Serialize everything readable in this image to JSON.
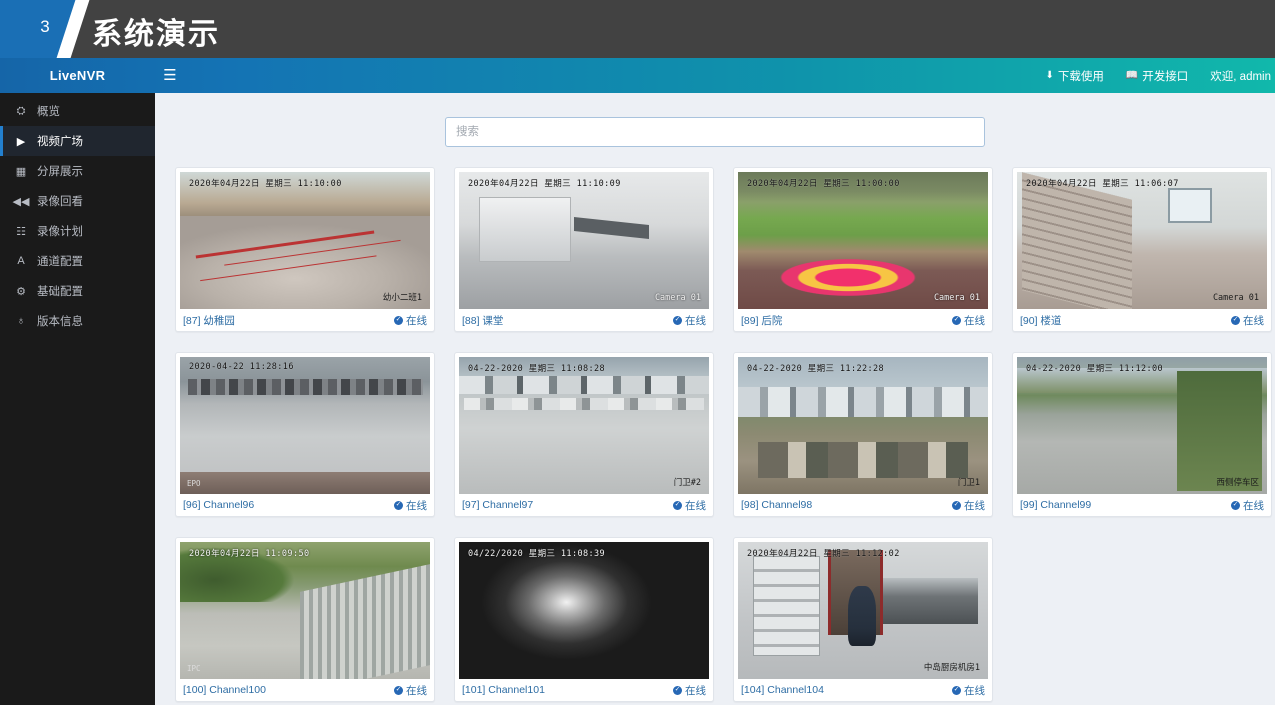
{
  "slide": {
    "number": "3",
    "title": "系统演示"
  },
  "navbar": {
    "brand": "LiveNVR",
    "menu_toggle_icon": "hamburger-icon",
    "right_items": [
      {
        "label": "下载使用",
        "icon": "download-icon"
      },
      {
        "label": "开发接口",
        "icon": "book-icon"
      },
      {
        "label": "欢迎, admin",
        "icon": ""
      }
    ]
  },
  "sidebar": {
    "items": [
      {
        "label": "概览",
        "icon": "dashboard-icon",
        "glyph": "⛭",
        "active": false
      },
      {
        "label": "视频广场",
        "icon": "play-icon",
        "glyph": "▶",
        "active": true
      },
      {
        "label": "分屏展示",
        "icon": "grid-icon",
        "glyph": "▦",
        "active": false
      },
      {
        "label": "录像回看",
        "icon": "rewind-icon",
        "glyph": "◀◀",
        "active": false
      },
      {
        "label": "录像计划",
        "icon": "calendar-icon",
        "glyph": "☷",
        "active": false
      },
      {
        "label": "通道配置",
        "icon": "font-a-icon",
        "glyph": "A",
        "active": false
      },
      {
        "label": "基础配置",
        "icon": "gear-icon",
        "glyph": "⚙",
        "active": false
      },
      {
        "label": "版本信息",
        "icon": "globe-icon",
        "glyph": "♁",
        "active": false
      }
    ]
  },
  "search": {
    "placeholder": "搜索",
    "value": ""
  },
  "status_label": "在线",
  "cards": [
    {
      "name": "[87] 幼稚园",
      "status": "在线",
      "timestamp": "2020年04月22日 星期三 11:10:00",
      "overlay_right": "幼小二班1",
      "overlay_left": "",
      "scene": "s-classroom",
      "ts_light": false,
      "corner_light": false
    },
    {
      "name": "[88] 课堂",
      "status": "在线",
      "timestamp": "2020年04月22日 星期三 11:10:09",
      "overlay_right": "Camera 01",
      "overlay_left": "",
      "scene": "s-lab",
      "ts_light": false,
      "corner_light": true
    },
    {
      "name": "[89] 后院",
      "status": "在线",
      "timestamp": "2020年04月22日 星期三 11:00:00",
      "overlay_right": "Camera 01",
      "overlay_left": "",
      "scene": "s-yard",
      "ts_light": false,
      "corner_light": true
    },
    {
      "name": "[90] 楼道",
      "status": "在线",
      "timestamp": "2020年04月22日 星期三 11:06:07",
      "overlay_right": "Camera 01",
      "overlay_left": "",
      "scene": "s-stair",
      "ts_light": false,
      "corner_light": false
    },
    {
      "name": "[96] Channel96",
      "status": "在线",
      "timestamp": "2020-04-22 11:28:16",
      "overlay_right": "",
      "overlay_left": "EPO",
      "scene": "s-parking",
      "ts_light": false,
      "corner_light": true
    },
    {
      "name": "[97] Channel97",
      "status": "在线",
      "timestamp": "04-22-2020 星期三 11:08:28",
      "overlay_right": "门卫#2",
      "overlay_left": "",
      "scene": "s-lot",
      "ts_light": false,
      "corner_light": false
    },
    {
      "name": "[98] Channel98",
      "status": "在线",
      "timestamp": "04-22-2020 星期三 11:22:28",
      "overlay_right": "门卫1",
      "overlay_left": "",
      "scene": "s-industrial",
      "ts_light": false,
      "corner_light": false
    },
    {
      "name": "[99] Channel99",
      "status": "在线",
      "timestamp": "04-22-2020 星期三 11:12:00",
      "overlay_right": "西侧停车区",
      "overlay_left": "",
      "scene": "s-road",
      "ts_light": false,
      "corner_light": false
    },
    {
      "name": "[100] Channel100",
      "status": "在线",
      "timestamp": "2020年04月22日 11:09:50",
      "overlay_right": "",
      "overlay_left": "IPC",
      "scene": "s-drive",
      "ts_light": true,
      "corner_light": true
    },
    {
      "name": "[101] Channel101",
      "status": "在线",
      "timestamp": "04/22/2020 星期三 11:08:39",
      "overlay_right": "",
      "overlay_left": "",
      "scene": "s-night",
      "ts_light": true,
      "corner_light": true
    },
    {
      "name": "[104] Channel104",
      "status": "在线",
      "timestamp": "2020年04月22日 星期三 11:12:02",
      "overlay_right": "中岛厨房机房1",
      "overlay_left": "",
      "scene": "s-kitchen",
      "ts_light": false,
      "corner_light": false
    }
  ]
}
